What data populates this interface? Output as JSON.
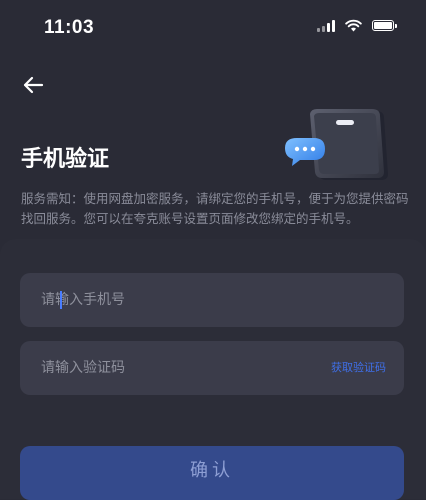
{
  "status_bar": {
    "time": "11:03"
  },
  "header": {
    "back_icon": "arrow-left-icon",
    "title": "手机验证"
  },
  "illustration": {
    "icons": [
      "phone-icon",
      "chat-bubble-icon"
    ]
  },
  "description": "服务需知：使用网盘加密服务，请绑定您的手机号，便于为您提供密码找回服务。您可以在夸克账号设置页面修改您绑定的手机号。",
  "form": {
    "phone_placeholder": "请输入手机号",
    "code_placeholder": "请输入验证码",
    "get_code_label": "获取验证码",
    "confirm_label": "确认"
  },
  "colors": {
    "background": "#2a2b36",
    "field": "#3b3c4a",
    "accent": "#3f6fe8",
    "button": "#344a8c"
  }
}
